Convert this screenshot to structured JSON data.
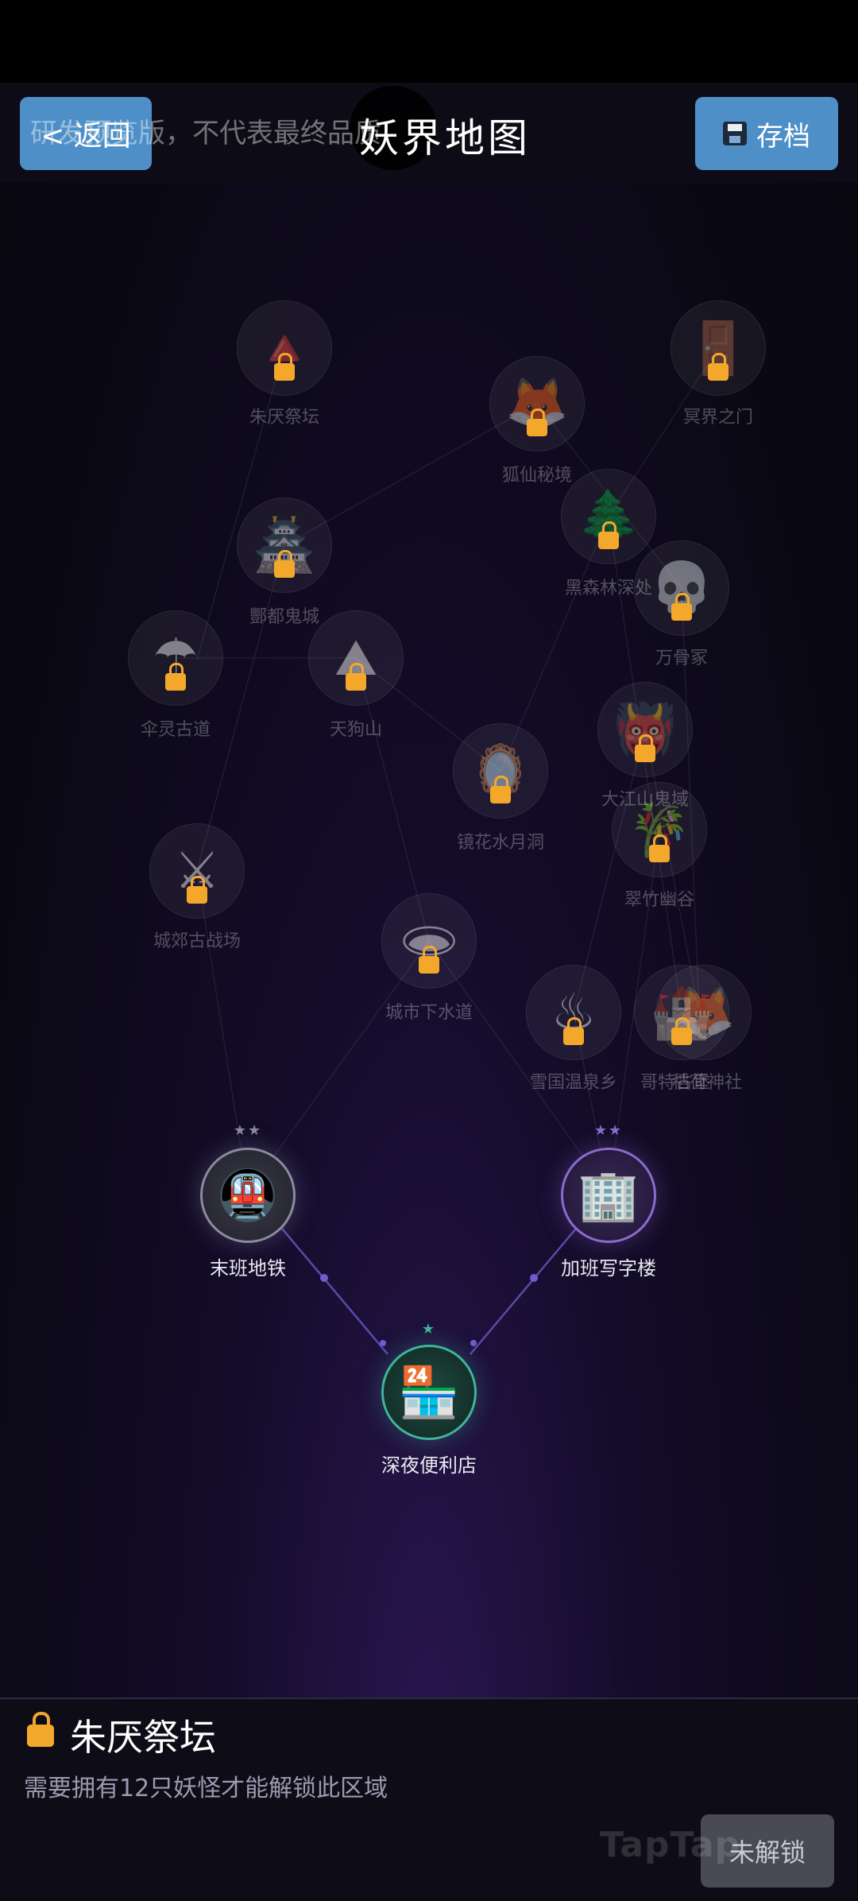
{
  "header": {
    "back_label": "< 返回",
    "title": "妖界地图",
    "save_label": "存档",
    "watermark": "研发预览版，不代表最终品质"
  },
  "locked_nodes": [
    {
      "id": "zhuyan",
      "name": "朱厌祭坛",
      "emoji": "🔺"
    },
    {
      "id": "mingjie",
      "name": "冥界之门",
      "emoji": "🚪"
    },
    {
      "id": "huxian",
      "name": "狐仙秘境",
      "emoji": "🦊"
    },
    {
      "id": "heisenlin",
      "name": "黑森林深处",
      "emoji": "🌲"
    },
    {
      "id": "fengdu",
      "name": "酆都鬼城",
      "emoji": "🏯"
    },
    {
      "id": "wangu",
      "name": "万骨冢",
      "emoji": "💀"
    },
    {
      "id": "sanling",
      "name": "伞灵古道",
      "emoji": "☂"
    },
    {
      "id": "tiangou",
      "name": "天狗山",
      "emoji": "⛰"
    },
    {
      "id": "dajiang",
      "name": "大江山鬼域",
      "emoji": "👹"
    },
    {
      "id": "jinghua",
      "name": "镜花水月洞",
      "emoji": "🪞"
    },
    {
      "id": "cuizhu",
      "name": "翠竹幽谷",
      "emoji": "🎋"
    },
    {
      "id": "chengjiao",
      "name": "城郊古战场",
      "emoji": "⚔"
    },
    {
      "id": "xiashui",
      "name": "城市下水道",
      "emoji": "🕳"
    },
    {
      "id": "xueguo",
      "name": "雪国温泉乡",
      "emoji": "♨"
    },
    {
      "id": "gete",
      "name": "哥特古堡",
      "emoji": "🏰"
    },
    {
      "id": "daohe",
      "name": "稻荷神社",
      "emoji": "🦊"
    }
  ],
  "open_nodes": [
    {
      "id": "subway",
      "name": "末班地铁",
      "emoji": "🚇",
      "stars": "★★",
      "color": "#8a8aa0"
    },
    {
      "id": "office",
      "name": "加班写字楼",
      "emoji": "🏢",
      "stars": "★★",
      "color": "#8a6bd0"
    },
    {
      "id": "store",
      "name": "深夜便利店",
      "emoji": "🏪",
      "stars": "★",
      "color": "#3fb39a"
    }
  ],
  "panel": {
    "title": "朱厌祭坛",
    "desc": "需要拥有12只妖怪才能解锁此区域",
    "unlock_label": "未解锁",
    "watermark": "TapTap"
  },
  "colors": {
    "button": "#4e8fc7",
    "lock": "#f3a82b",
    "path": "#5a4aa8"
  }
}
